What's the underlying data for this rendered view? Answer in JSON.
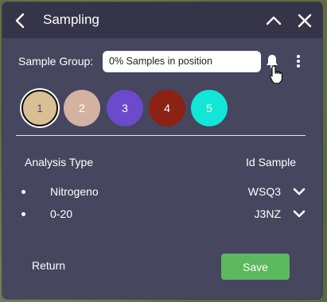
{
  "header": {
    "title": "Sampling"
  },
  "group": {
    "label": "Sample Group:",
    "value": "0% Samples in position"
  },
  "samples": [
    {
      "label": "1",
      "color": "#d9bf93",
      "text_color": "#555555",
      "selected": true
    },
    {
      "label": "2",
      "color": "#d3b2a2",
      "text_color": "#ffffff",
      "selected": false
    },
    {
      "label": "3",
      "color": "#6b4acb",
      "text_color": "#ffffff",
      "selected": false
    },
    {
      "label": "4",
      "color": "#8b2213",
      "text_color": "#ffffff",
      "selected": false
    },
    {
      "label": "5",
      "color": "#12e6d6",
      "text_color": "#ffffff",
      "selected": false
    }
  ],
  "table": {
    "headers": {
      "analysis": "Analysis Type",
      "id": "Id Sample"
    },
    "rows": [
      {
        "analysis": "Nitrogeno",
        "id": "WSQ3"
      },
      {
        "analysis": "0-20",
        "id": "J3NZ"
      }
    ]
  },
  "footer": {
    "return_label": "Return",
    "save_label": "Save",
    "save_color": "#5cb85c"
  },
  "icons": [
    "chevron-left-icon",
    "chevron-up-icon",
    "close-icon",
    "bell-icon",
    "kebab-menu-icon",
    "chevron-down-icon",
    "hand-cursor-icon"
  ]
}
